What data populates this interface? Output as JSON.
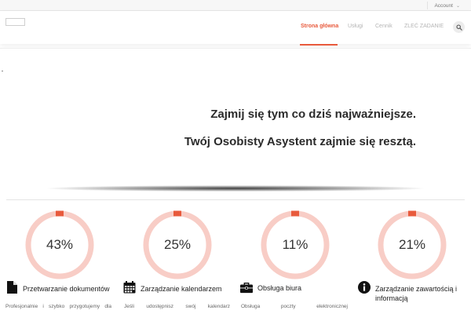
{
  "topbar": {
    "account_label": "Account"
  },
  "nav": {
    "items": [
      {
        "label": "Strona główna",
        "active": true
      },
      {
        "label": "Usługi",
        "active": false
      },
      {
        "label": "Cennik",
        "active": false
      },
      {
        "label": "ZLEĆ ZADANIE",
        "active": false
      }
    ],
    "accent_color": "#e85a3c"
  },
  "hero": {
    "line1": "Zajmij się tym co dziś najważniejsze.",
    "line2": "Twój Osobisty Asystent zajmie się resztą."
  },
  "stats": [
    {
      "value": "43%",
      "fraction": 0.43
    },
    {
      "value": "25%",
      "fraction": 0.25
    },
    {
      "value": "11%",
      "fraction": 0.11
    },
    {
      "value": "21%",
      "fraction": 0.21
    }
  ],
  "colors": {
    "ring_track": "#f8cdc6",
    "ring_accent": "#e85a3c"
  },
  "features": [
    {
      "icon": "document-icon",
      "title": "Przetwarzanie dokumentów",
      "desc": "Profesjonalnie i szybko przygotujemy dla"
    },
    {
      "icon": "calendar-icon",
      "title": "Zarządzanie kalendarzem",
      "desc": "Jeśli udostępnisz swój kalendarz"
    },
    {
      "icon": "briefcase-icon",
      "title": "Obsługa biura",
      "desc": "Obsługa poczty elektronicznej"
    },
    {
      "icon": "info-icon",
      "title": "Zarządzanie zawartością i informacją",
      "desc": ""
    }
  ]
}
